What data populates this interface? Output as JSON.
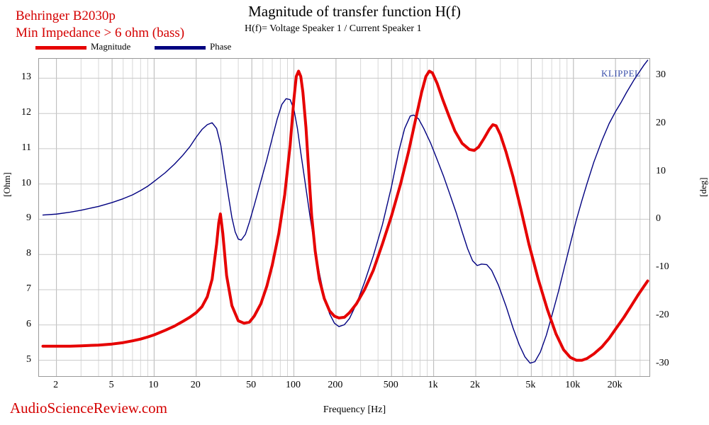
{
  "header": {
    "brand_line1": "Behringer B2030p",
    "brand_line2": "Min Impedance > 6 ohm (bass)",
    "title": "Magnitude of transfer function H(f)",
    "subtitle": "H(f)= Voltage Speaker 1 / Current Speaker 1",
    "watermark": "KLIPPEL",
    "footer": "AudioScienceReview.com"
  },
  "legend": {
    "items": [
      {
        "label": "Magnitude",
        "color": "#e60000"
      },
      {
        "label": "Phase",
        "color": "#000080"
      }
    ]
  },
  "chart_data": {
    "type": "line",
    "title": "Magnitude of transfer function H(f)",
    "subtitle": "H(f)= Voltage Speaker 1 / Current Speaker 1",
    "xlabel": "Frequency [Hz]",
    "ylabel_left": "[Ohm]",
    "ylabel_right": "[deg]",
    "xscale": "log",
    "xlim": [
      1.5,
      35000
    ],
    "grid": true,
    "legend_position": "top-left",
    "x_ticks": [
      2,
      5,
      10,
      20,
      50,
      100,
      200,
      500,
      1000,
      2000,
      5000,
      10000,
      20000
    ],
    "x_tick_labels": [
      "2",
      "5",
      "10",
      "20",
      "50",
      "100",
      "200",
      "500",
      "1k",
      "2k",
      "5k",
      "10k",
      "20k"
    ],
    "y_left_ticks": [
      5,
      6,
      7,
      8,
      9,
      10,
      11,
      12,
      13
    ],
    "y_left_tick_labels": [
      "5",
      "6",
      "7",
      "8",
      "9",
      "10",
      "11",
      "12",
      "13"
    ],
    "y_left_lim": [
      4.55,
      13.55
    ],
    "y_right_ticks": [
      -30,
      -20,
      -10,
      0,
      10,
      20,
      30
    ],
    "y_right_tick_labels": [
      "-30",
      "-20",
      "-10",
      "0",
      "10",
      "20",
      "30"
    ],
    "y_right_lim": [
      -32.5,
      33.5
    ],
    "series": [
      {
        "name": "Magnitude",
        "color": "#e60000",
        "axis": "left",
        "unit": "Ohm",
        "points": [
          [
            1.6,
            5.4
          ],
          [
            2,
            5.4
          ],
          [
            2.5,
            5.4
          ],
          [
            3,
            5.41
          ],
          [
            4,
            5.43
          ],
          [
            5,
            5.46
          ],
          [
            6,
            5.5
          ],
          [
            7,
            5.55
          ],
          [
            8,
            5.6
          ],
          [
            9,
            5.66
          ],
          [
            10,
            5.72
          ],
          [
            12,
            5.85
          ],
          [
            14,
            5.97
          ],
          [
            16,
            6.1
          ],
          [
            18,
            6.22
          ],
          [
            20,
            6.35
          ],
          [
            22,
            6.52
          ],
          [
            24,
            6.8
          ],
          [
            26,
            7.3
          ],
          [
            28,
            8.3
          ],
          [
            29,
            8.9
          ],
          [
            29.8,
            9.15
          ],
          [
            31,
            8.6
          ],
          [
            33,
            7.4
          ],
          [
            36,
            6.55
          ],
          [
            40,
            6.12
          ],
          [
            44,
            6.05
          ],
          [
            48,
            6.08
          ],
          [
            52,
            6.25
          ],
          [
            58,
            6.6
          ],
          [
            64,
            7.1
          ],
          [
            70,
            7.7
          ],
          [
            78,
            8.6
          ],
          [
            86,
            9.7
          ],
          [
            94,
            11.1
          ],
          [
            100,
            12.4
          ],
          [
            104,
            13.05
          ],
          [
            108,
            13.2
          ],
          [
            112,
            13.05
          ],
          [
            116,
            12.6
          ],
          [
            122,
            11.6
          ],
          [
            128,
            10.3
          ],
          [
            134,
            9.1
          ],
          [
            142,
            8.1
          ],
          [
            152,
            7.3
          ],
          [
            165,
            6.75
          ],
          [
            180,
            6.4
          ],
          [
            195,
            6.25
          ],
          [
            210,
            6.2
          ],
          [
            230,
            6.22
          ],
          [
            250,
            6.35
          ],
          [
            280,
            6.6
          ],
          [
            320,
            7.0
          ],
          [
            370,
            7.55
          ],
          [
            430,
            8.3
          ],
          [
            500,
            9.1
          ],
          [
            580,
            10.0
          ],
          [
            660,
            10.9
          ],
          [
            740,
            11.8
          ],
          [
            820,
            12.6
          ],
          [
            880,
            13.05
          ],
          [
            930,
            13.2
          ],
          [
            980,
            13.15
          ],
          [
            1060,
            12.85
          ],
          [
            1160,
            12.4
          ],
          [
            1280,
            11.95
          ],
          [
            1420,
            11.5
          ],
          [
            1600,
            11.15
          ],
          [
            1800,
            10.98
          ],
          [
            1950,
            10.95
          ],
          [
            2100,
            11.05
          ],
          [
            2300,
            11.3
          ],
          [
            2500,
            11.55
          ],
          [
            2650,
            11.68
          ],
          [
            2800,
            11.65
          ],
          [
            3000,
            11.4
          ],
          [
            3300,
            10.9
          ],
          [
            3700,
            10.2
          ],
          [
            4200,
            9.3
          ],
          [
            4800,
            8.3
          ],
          [
            5600,
            7.3
          ],
          [
            6500,
            6.45
          ],
          [
            7500,
            5.75
          ],
          [
            8500,
            5.3
          ],
          [
            9500,
            5.08
          ],
          [
            10500,
            5.0
          ],
          [
            11500,
            5.0
          ],
          [
            12500,
            5.05
          ],
          [
            14000,
            5.18
          ],
          [
            16000,
            5.38
          ],
          [
            18000,
            5.62
          ],
          [
            20000,
            5.88
          ],
          [
            23000,
            6.22
          ],
          [
            26000,
            6.55
          ],
          [
            29000,
            6.85
          ],
          [
            32000,
            7.1
          ],
          [
            34000,
            7.25
          ]
        ]
      },
      {
        "name": "Phase",
        "color": "#000080",
        "axis": "right",
        "unit": "deg",
        "points": [
          [
            1.6,
            1.0
          ],
          [
            2,
            1.2
          ],
          [
            2.5,
            1.6
          ],
          [
            3,
            2.0
          ],
          [
            4,
            2.8
          ],
          [
            5,
            3.6
          ],
          [
            6,
            4.4
          ],
          [
            7,
            5.2
          ],
          [
            8,
            6.1
          ],
          [
            9,
            7.0
          ],
          [
            10,
            8.0
          ],
          [
            12,
            9.8
          ],
          [
            14,
            11.6
          ],
          [
            16,
            13.4
          ],
          [
            18,
            15.2
          ],
          [
            20,
            17.2
          ],
          [
            22,
            18.8
          ],
          [
            24,
            19.8
          ],
          [
            26,
            20.2
          ],
          [
            28,
            19.0
          ],
          [
            30,
            15.5
          ],
          [
            32,
            10.0
          ],
          [
            34,
            5.0
          ],
          [
            36,
            0.5
          ],
          [
            38,
            -2.5
          ],
          [
            40,
            -4.0
          ],
          [
            42,
            -4.2
          ],
          [
            45,
            -3.0
          ],
          [
            48,
            -0.5
          ],
          [
            52,
            3.0
          ],
          [
            58,
            8.0
          ],
          [
            64,
            12.5
          ],
          [
            70,
            17.0
          ],
          [
            76,
            21.0
          ],
          [
            82,
            24.0
          ],
          [
            88,
            25.2
          ],
          [
            94,
            25.0
          ],
          [
            100,
            23.0
          ],
          [
            106,
            19.0
          ],
          [
            112,
            14.0
          ],
          [
            120,
            8.0
          ],
          [
            130,
            1.0
          ],
          [
            140,
            -5.0
          ],
          [
            152,
            -11.0
          ],
          [
            165,
            -16.0
          ],
          [
            180,
            -19.5
          ],
          [
            195,
            -21.5
          ],
          [
            210,
            -22.2
          ],
          [
            230,
            -21.8
          ],
          [
            250,
            -20.5
          ],
          [
            280,
            -17.5
          ],
          [
            320,
            -13.0
          ],
          [
            370,
            -7.5
          ],
          [
            430,
            -1.0
          ],
          [
            500,
            7.0
          ],
          [
            560,
            14.0
          ],
          [
            620,
            19.0
          ],
          [
            680,
            21.6
          ],
          [
            720,
            21.8
          ],
          [
            780,
            21.0
          ],
          [
            850,
            19.0
          ],
          [
            950,
            16.0
          ],
          [
            1060,
            12.5
          ],
          [
            1180,
            9.0
          ],
          [
            1300,
            5.5
          ],
          [
            1450,
            1.5
          ],
          [
            1600,
            -2.5
          ],
          [
            1750,
            -6.0
          ],
          [
            1900,
            -8.5
          ],
          [
            2050,
            -9.5
          ],
          [
            2200,
            -9.2
          ],
          [
            2400,
            -9.3
          ],
          [
            2600,
            -10.5
          ],
          [
            2900,
            -13.5
          ],
          [
            3300,
            -18.0
          ],
          [
            3700,
            -22.5
          ],
          [
            4100,
            -26.0
          ],
          [
            4500,
            -28.5
          ],
          [
            4900,
            -29.8
          ],
          [
            5300,
            -29.5
          ],
          [
            5800,
            -27.5
          ],
          [
            6400,
            -24.0
          ],
          [
            7000,
            -20.0
          ],
          [
            7800,
            -15.0
          ],
          [
            8600,
            -10.0
          ],
          [
            9500,
            -5.0
          ],
          [
            10500,
            0.0
          ],
          [
            11500,
            4.0
          ],
          [
            12500,
            7.5
          ],
          [
            14000,
            12.0
          ],
          [
            16000,
            16.5
          ],
          [
            18000,
            20.0
          ],
          [
            20000,
            22.5
          ],
          [
            22000,
            24.5
          ],
          [
            24000,
            26.5
          ],
          [
            27000,
            29.0
          ],
          [
            30000,
            31.0
          ],
          [
            32000,
            32.2
          ],
          [
            34000,
            33.2
          ]
        ]
      }
    ]
  }
}
